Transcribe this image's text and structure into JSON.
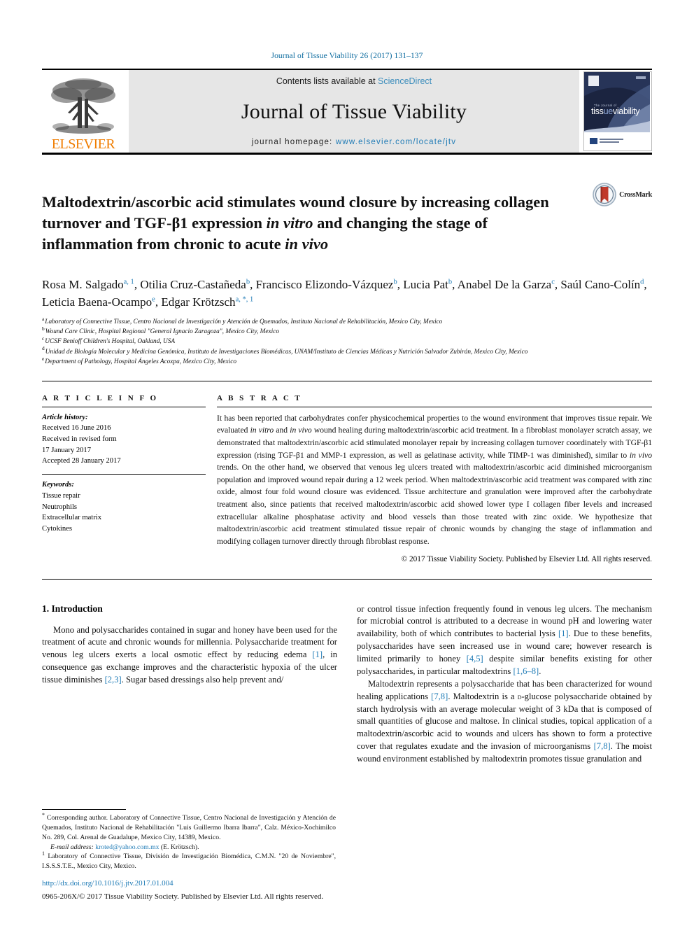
{
  "running_head": "Journal of Tissue Viability 26 (2017) 131–137",
  "masthead": {
    "contents_prefix": "Contents lists available at ",
    "sciencedirect": "ScienceDirect",
    "journal_name": "Journal of Tissue Viability",
    "homepage_prefix": "journal homepage: ",
    "homepage_url": "www.elsevier.com/locate/jtv",
    "publisher": "ELSEVIER",
    "cover_title": "tissueviability",
    "cover_kicker": "The Journal of"
  },
  "article": {
    "title_part1": "Maltodextrin/ascorbic acid stimulates wound closure by increasing collagen turnover and TGF-β1 expression ",
    "title_italic1": "in vitro",
    "title_part2": " and changing the stage of inflammation from chronic to acute ",
    "title_italic2": "in vivo",
    "crossmark_label": "CrossMark"
  },
  "authors": [
    {
      "name": "Rosa M. Salgado",
      "marks": "a, 1",
      "sep": ", "
    },
    {
      "name": "Otilia Cruz-Castañeda",
      "marks": "b",
      "sep": ", "
    },
    {
      "name": "Francisco Elizondo-Vázquez",
      "marks": "b",
      "sep": ", "
    },
    {
      "name": "Lucia Pat",
      "marks": "b",
      "sep": ", "
    },
    {
      "name": "Anabel De la Garza",
      "marks": "c",
      "sep": ", "
    },
    {
      "name": "Saúl Cano-Colín",
      "marks": "d",
      "sep": ", "
    },
    {
      "name": "Leticia Baena-Ocampo",
      "marks": "e",
      "sep": ", "
    },
    {
      "name": "Edgar Krötzsch",
      "marks": "a, *, 1",
      "sep": ""
    }
  ],
  "affiliations": [
    {
      "mark": "a",
      "text": "Laboratory of Connective Tissue, Centro Nacional de Investigación y Atención de Quemados, Instituto Nacional de Rehabilitación, Mexico City, Mexico"
    },
    {
      "mark": "b",
      "text": "Wound Care Clinic, Hospital Regional \"General Ignacio Zaragoza\", Mexico City, Mexico"
    },
    {
      "mark": "c",
      "text": "UCSF Benioff Children's Hospital, Oakland, USA"
    },
    {
      "mark": "d",
      "text": "Unidad de Biología Molecular y Medicina Genómica, Instituto de Investigaciones Biomédicas, UNAM/Instituto de Ciencias Médicas y Nutrición Salvador Zubirán, Mexico City, Mexico"
    },
    {
      "mark": "e",
      "text": "Department of Pathology, Hospital Ángeles Acoxpa, Mexico City, Mexico"
    }
  ],
  "article_info": {
    "heading": "A R T I C L E   I N F O",
    "history_label": "Article history:",
    "history_lines": [
      "Received 16 June 2016",
      "Received in revised form",
      "17 January 2017",
      "Accepted 28 January 2017"
    ],
    "keywords_label": "Keywords:",
    "keywords": [
      "Tissue repair",
      "Neutrophils",
      "Extracellular matrix",
      "Cytokines"
    ]
  },
  "abstract": {
    "heading": "A B S T R A C T",
    "p1": "It has been reported that carbohydrates confer physicochemical properties to the wound environment that improves tissue repair. We evaluated ",
    "i1": "in vitro",
    "p2": " and ",
    "i2": "in vivo",
    "p3": " wound healing during maltodextrin/ascorbic acid treatment. In a fibroblast monolayer scratch assay, we demonstrated that maltodextrin/ascorbic acid stimulated monolayer repair by increasing collagen turnover coordinately with TGF-β1 expression (rising TGF-β1 and MMP-1 expression, as well as gelatinase activity, while TIMP-1 was diminished), similar to ",
    "i3": "in vivo",
    "p4": " trends. On the other hand, we observed that venous leg ulcers treated with maltodextrin/ascorbic acid diminished microorganism population and improved wound repair during a 12 week period. When maltodextrin/ascorbic acid treatment was compared with zinc oxide, almost four fold wound closure was evidenced. Tissue architecture and granulation were improved after the carbohydrate treatment also, since patients that received maltodextrin/ascorbic acid showed lower type I collagen fiber levels and increased extracellular alkaline phosphatase activity and blood vessels than those treated with zinc oxide. We hypothesize that maltodextrin/ascorbic acid treatment stimulated tissue repair of chronic wounds by changing the stage of inflammation and modifying collagen turnover directly through fibroblast response.",
    "copyright": "© 2017 Tissue Viability Society. Published by Elsevier Ltd. All rights reserved."
  },
  "intro": {
    "heading": "1. Introduction",
    "left_p1_a": "Mono and polysaccharides contained in sugar and honey have been used for the treatment of acute and chronic wounds for millennia. Polysaccharide treatment for venous leg ulcers exerts a local osmotic effect by reducing edema ",
    "left_ref1": "[1]",
    "left_p1_b": ", in consequence gas exchange improves and the characteristic hypoxia of the ulcer tissue diminishes ",
    "left_ref2": "[2,3]",
    "left_p1_c": ". Sugar based dressings also help prevent and/",
    "right_p1_a": "or control tissue infection frequently found in venous leg ulcers. The mechanism for microbial control is attributed to a decrease in wound pH and lowering water availability, both of which contributes to bacterial lysis ",
    "right_ref1": "[1]",
    "right_p1_b": ". Due to these benefits, polysaccharides have seen increased use in wound care; however research is limited primarily to honey ",
    "right_ref2": "[4,5]",
    "right_p1_c": " despite similar benefits existing for other polysaccharides, in particular maltodextrins ",
    "right_ref3": "[1,6–8]",
    "right_p1_d": ".",
    "right_p2_a": "Maltodextrin represents a polysaccharide that has been characterized for wound healing applications ",
    "right_ref4": "[7,8]",
    "right_p2_b": ". Maltodextrin is a ",
    "right_smallcaps": "d",
    "right_p2_c": "-glucose polysaccharide obtained by starch hydrolysis with an average molecular weight of 3 kDa that is composed of small quantities of glucose and maltose. In clinical studies, topical application of a maltodextrin/ascorbic acid to wounds and ulcers has shown to form a protective cover that regulates exudate and the invasion of microorganisms ",
    "right_ref5": "[7,8]",
    "right_p2_d": ". The moist wound environment established by maltodextrin promotes tissue granulation and"
  },
  "footnotes": {
    "corresponding_mark": "*",
    "corresponding": " Corresponding author. Laboratory of Connective Tissue, Centro Nacional de Investigación y Atención de Quemados, Instituto Nacional de Rehabilitación \"Luis Guillermo Ibarra Ibarra\", Calz. México-Xochimilco No. 289, Col. Arenal de Guadalupe, Mexico City, 14389, Mexico.",
    "email_label": "E-mail address:",
    "email": "kroted@yahoo.com.mx",
    "email_suffix": " (E. Krötzsch).",
    "fn1_mark": "1",
    "fn1": " Laboratory of Connective Tissue, División de Investigación Biomédica, C.M.N. \"20 de Noviembre\", I.S.S.S.T.E., Mexico City, Mexico."
  },
  "doi": {
    "url": "http://dx.doi.org/10.1016/j.jtv.2017.01.004",
    "issn_line": "0965-206X/© 2017 Tissue Viability Society. Published by Elsevier Ltd. All rights reserved."
  },
  "colors": {
    "link": "#1f7bb6",
    "elsevier_orange": "#f07d00",
    "crossmark_red": "#c0392b",
    "masthead_grey": "#e6e6e6"
  }
}
